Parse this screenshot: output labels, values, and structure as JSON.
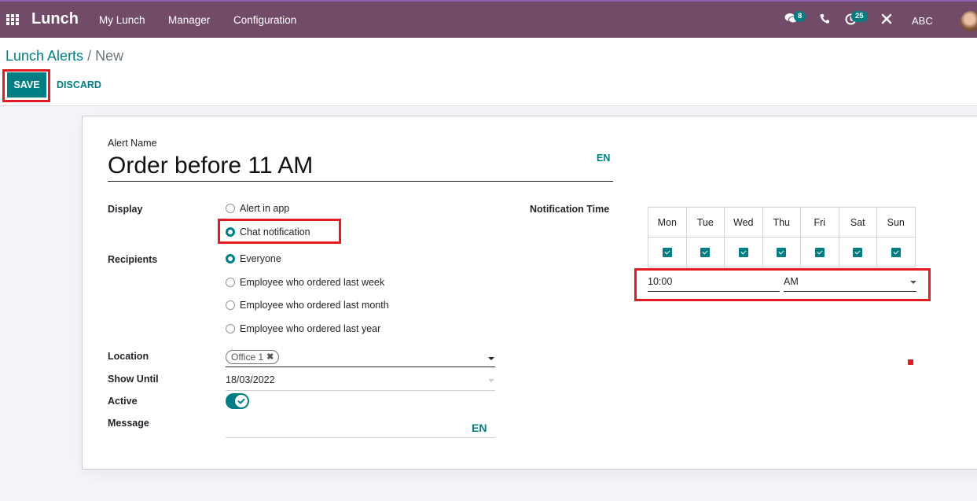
{
  "navbar": {
    "app_name": "Lunch",
    "menu": [
      "My Lunch",
      "Manager",
      "Configuration"
    ],
    "messages_count": "8",
    "activities_count": "25",
    "company": "ABC",
    "icons": {
      "apps": "apps-grid-icon",
      "messages": "chat-bubbles-icon",
      "phone": "phone-icon",
      "activities": "clock-icon",
      "debug": "tools-icon"
    }
  },
  "breadcrumb": {
    "parent": "Lunch Alerts",
    "separator": " / ",
    "current": "New"
  },
  "actions": {
    "save": "SAVE",
    "discard": "DISCARD"
  },
  "form": {
    "alert_name_label": "Alert Name",
    "alert_name_value": "Order before 11 AM",
    "lang": "EN",
    "display": {
      "label": "Display",
      "options": [
        "Alert in app",
        "Chat notification"
      ],
      "selected": "Chat notification"
    },
    "recipients": {
      "label": "Recipients",
      "options": [
        "Everyone",
        "Employee who ordered last week",
        "Employee who ordered last month",
        "Employee who ordered last year"
      ],
      "selected": "Everyone"
    },
    "location": {
      "label": "Location",
      "tags": [
        "Office 1"
      ]
    },
    "show_until": {
      "label": "Show Until",
      "value": "18/03/2022"
    },
    "active": {
      "label": "Active",
      "value": true
    },
    "message": {
      "label": "Message",
      "value": "",
      "lang": "EN"
    },
    "notification_time": {
      "label": "Notification Time",
      "days": [
        "Mon",
        "Tue",
        "Wed",
        "Thu",
        "Fri",
        "Sat",
        "Sun"
      ],
      "checked": [
        true,
        true,
        true,
        true,
        true,
        true,
        true
      ],
      "time": "10:00",
      "period": "AM"
    }
  },
  "colors": {
    "navbar": "#714b67",
    "primary": "#017e84",
    "highlight": "#e31b23"
  }
}
